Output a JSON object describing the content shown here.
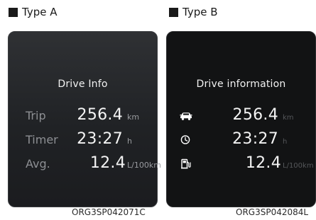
{
  "type_a": {
    "heading": "Type A",
    "title": "Drive Info",
    "rows": [
      {
        "label": "Trip",
        "value": "256.4",
        "unit": "km"
      },
      {
        "label": "Timer",
        "value": "23:27",
        "unit": "h"
      },
      {
        "label": "Avg.",
        "value": "12.4",
        "unit": "L/100km"
      }
    ],
    "caption": "ORG3SP042071C"
  },
  "type_b": {
    "heading": "Type B",
    "title": "Drive information",
    "rows": [
      {
        "icon": "car-icon",
        "value": "256.4",
        "unit": "km"
      },
      {
        "icon": "clock-icon",
        "value": "23:27",
        "unit": "h"
      },
      {
        "icon": "fuel-pump-icon",
        "value": "12.4",
        "unit": "L/100km"
      }
    ],
    "caption": "ORG3SP042084L"
  }
}
